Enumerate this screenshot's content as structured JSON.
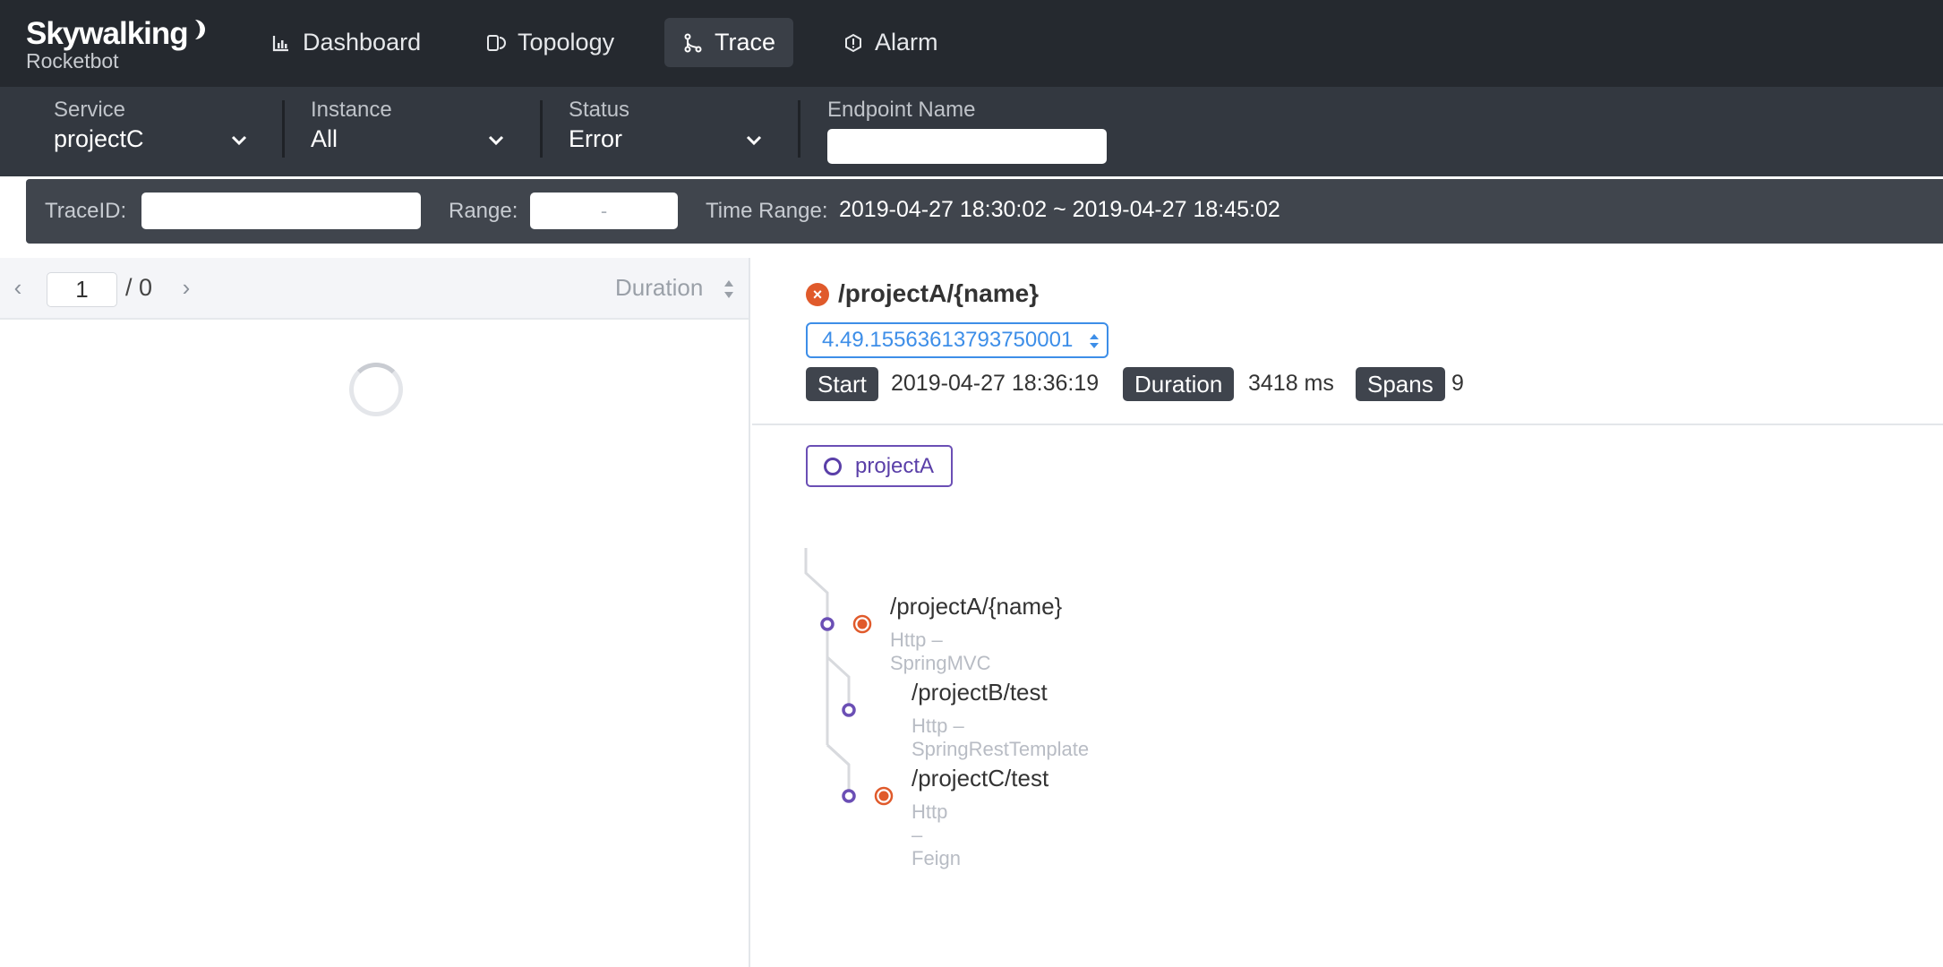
{
  "app": {
    "brand": "Skywalking",
    "subtitle": "Rocketbot"
  },
  "nav": {
    "dashboard": "Dashboard",
    "topology": "Topology",
    "trace": "Trace",
    "alarm": "Alarm"
  },
  "filters": {
    "service": {
      "label": "Service",
      "value": "projectC"
    },
    "instance": {
      "label": "Instance",
      "value": "All"
    },
    "status": {
      "label": "Status",
      "value": "Error"
    },
    "endpoint": {
      "label": "Endpoint Name",
      "value": ""
    },
    "traceid": {
      "label": "TraceID:",
      "value": ""
    },
    "range": {
      "label": "Range:",
      "value": "-"
    },
    "time_range": {
      "label": "Time Range:",
      "value": "2019-04-27 18:30:02 ~ 2019-04-27 18:45:02"
    }
  },
  "list": {
    "page": "1",
    "total": "/ 0",
    "sort_label": "Duration"
  },
  "detail": {
    "endpoint": "/projectA/{name}",
    "trace_id": "4.49.15563613793750001",
    "start_label": "Start",
    "start_value": "2019-04-27 18:36:19",
    "duration_label": "Duration",
    "duration_value": "3418 ms",
    "spans_label": "Spans",
    "spans_value": "9",
    "service_chip": "projectA",
    "spans": [
      {
        "name": "/projectA/{name}",
        "sub": "Http – SpringMVC",
        "error": true
      },
      {
        "name": "/projectB/test",
        "sub": "Http – SpringRestTemplate",
        "error": false
      },
      {
        "name": "/projectC/test",
        "sub": "Http – Feign",
        "error": true
      }
    ]
  },
  "colors": {
    "accent": "#3d8ee8",
    "error": "#e05a2b",
    "purple": "#6b4fb5",
    "nav_bg": "#25292f"
  }
}
